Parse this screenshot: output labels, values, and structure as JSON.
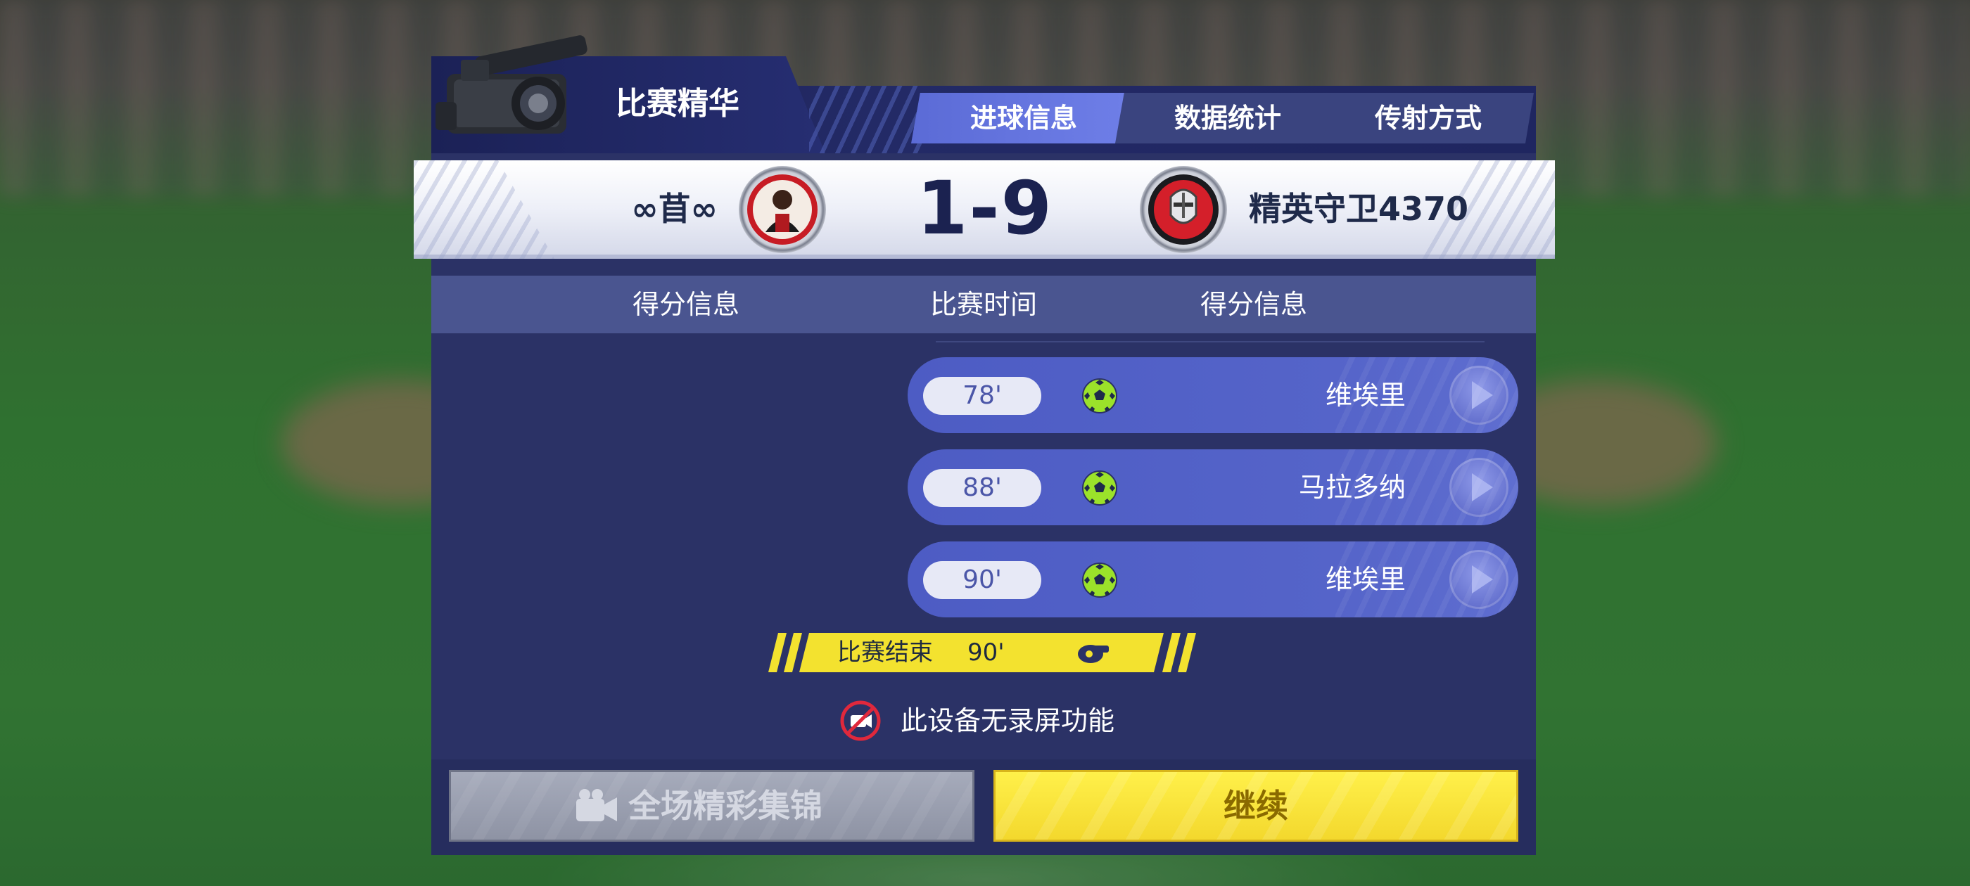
{
  "header": {
    "title": "比赛精华",
    "tabs": [
      {
        "label": "进球信息",
        "active": true
      },
      {
        "label": "数据统计",
        "active": false
      },
      {
        "label": "传射方式",
        "active": false
      }
    ]
  },
  "scoreboard": {
    "home_team": "∞苜∞",
    "away_team": "精英守卫4370",
    "score": "1-9"
  },
  "columns": {
    "left": "得分信息",
    "middle": "比赛时间",
    "right": "得分信息"
  },
  "goals": [
    {
      "time": "78'",
      "scorer": "维埃里",
      "side": "away"
    },
    {
      "time": "88'",
      "scorer": "马拉多纳",
      "side": "away"
    },
    {
      "time": "90'",
      "scorer": "维埃里",
      "side": "away"
    }
  ],
  "match_end": {
    "label": "比赛结束",
    "time": "90'"
  },
  "notice": "此设备无录屏功能",
  "buttons": {
    "highlights": "全场精彩集锦",
    "continue": "继续"
  },
  "colors": {
    "panel": "#2b3266",
    "tab_active": "#6373e0",
    "goal_row": "#5260c7",
    "accent_yellow": "#f3e22f",
    "ball_green": "#9be22a"
  },
  "icons": {
    "camera": "video-camera-icon",
    "ball": "soccer-ball-icon",
    "play": "play-icon",
    "whistle": "whistle-icon",
    "no_record": "no-record-icon"
  }
}
